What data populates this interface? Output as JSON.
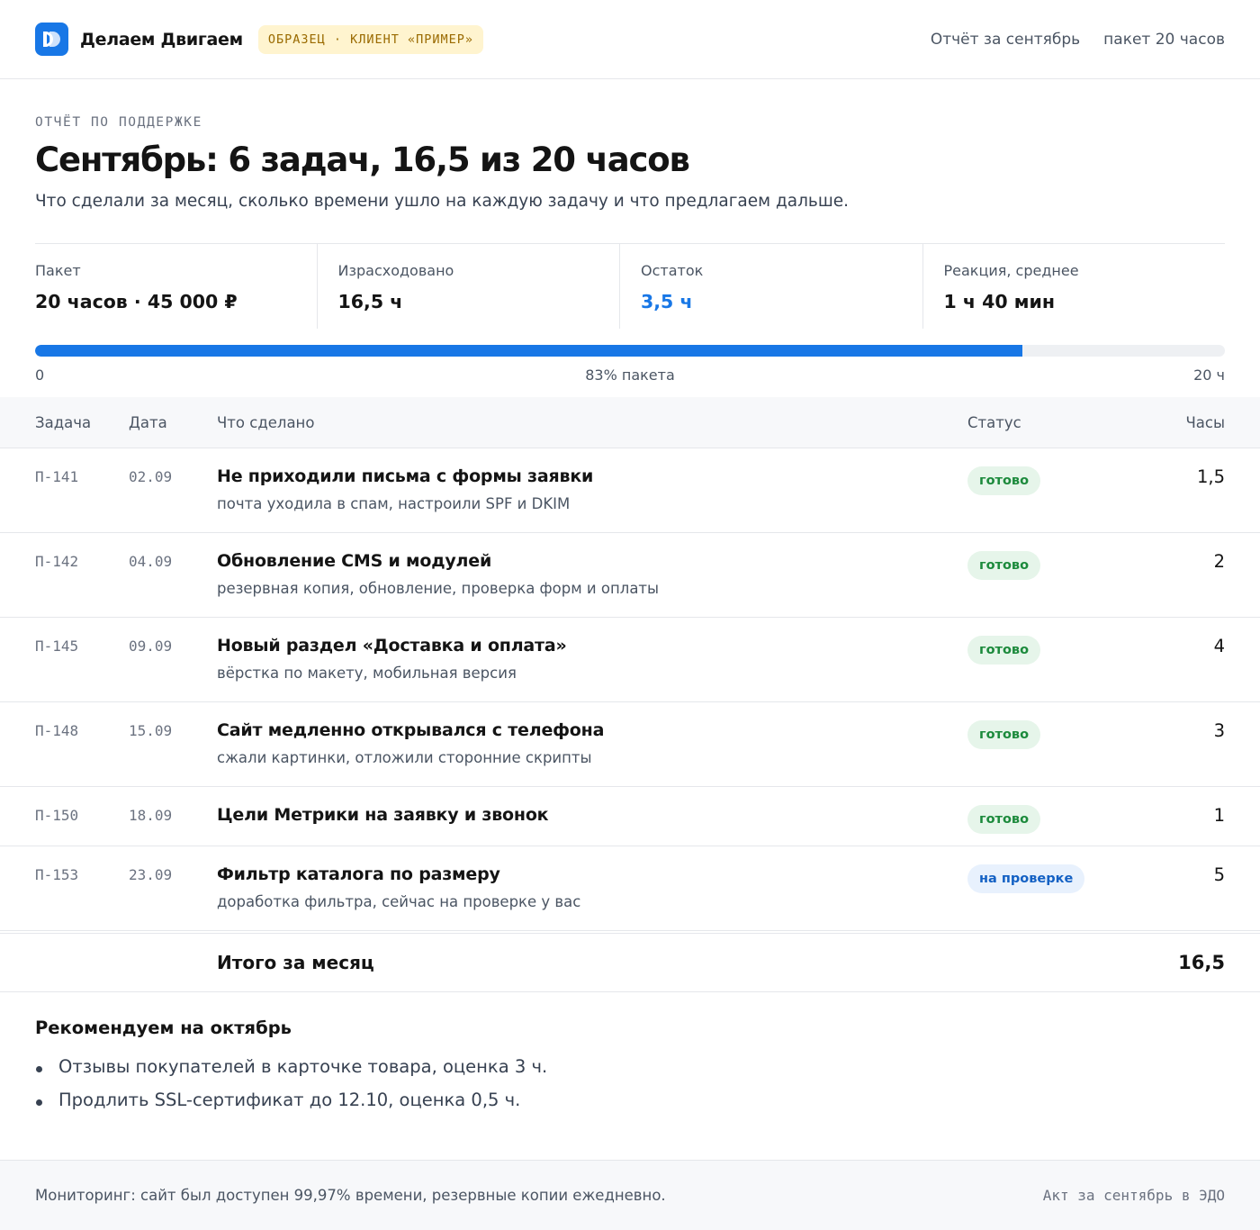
{
  "header": {
    "brand": "Делаем Двигаем",
    "sample_badge": "ОБРАЗЕЦ · КЛИЕНТ «ПРИМЕР»",
    "report_link": "Отчёт за сентябрь",
    "package_link": "пакет 20 часов"
  },
  "hero": {
    "eyebrow": "ОТЧЁТ ПО ПОДДЕРЖКЕ",
    "title": "Сентябрь: 6 задач, 16,5 из 20 часов",
    "lead": "Что сделали за месяц, сколько времени ушло на каждую задачу и что предлагаем дальше."
  },
  "stats": [
    {
      "label": "Пакет",
      "value": "20 часов · 45 000 ₽"
    },
    {
      "label": "Израсходовано",
      "value": "16,5 ч"
    },
    {
      "label": "Остаток",
      "value": "3,5 ч"
    },
    {
      "label": "Реакция, среднее",
      "value": "1 ч 40 мин"
    }
  ],
  "progress": {
    "used_fraction": 0.83,
    "min_label": "0",
    "mid_label": "83% пакета",
    "max_label": "20 ч"
  },
  "table": {
    "headers": {
      "id": "Задача",
      "date": "Дата",
      "what": "Что сделано",
      "status": "Статус",
      "hours": "Часы"
    },
    "rows": [
      {
        "id": "П-141",
        "date": "02.09",
        "title": "Не приходили письма с формы заявки",
        "sub": "почта уходила в спам, настроили SPF и DKIM",
        "status": "готово",
        "status_kind": "done",
        "hours": "1,5"
      },
      {
        "id": "П-142",
        "date": "04.09",
        "title": "Обновление CMS и модулей",
        "sub": "резервная копия, обновление, проверка форм и оплаты",
        "status": "готово",
        "status_kind": "done",
        "hours": "2"
      },
      {
        "id": "П-145",
        "date": "09.09",
        "title": "Новый раздел «Доставка и оплата»",
        "sub": "вёрстка по макету, мобильная версия",
        "status": "готово",
        "status_kind": "done",
        "hours": "4"
      },
      {
        "id": "П-148",
        "date": "15.09",
        "title": "Сайт медленно открывался с телефона",
        "sub": "сжали картинки, отложили сторонние скрипты",
        "status": "готово",
        "status_kind": "done",
        "hours": "3"
      },
      {
        "id": "П-150",
        "date": "18.09",
        "title": "Цели Метрики на заявку и звонок",
        "sub": "",
        "status": "готово",
        "status_kind": "done",
        "hours": "1"
      },
      {
        "id": "П-153",
        "date": "23.09",
        "title": "Фильтр каталога по размеру",
        "sub": "доработка фильтра, сейчас на проверке у вас",
        "status": "на проверке",
        "status_kind": "review",
        "hours": "5"
      }
    ],
    "total_label": "Итого за месяц",
    "total_value": "16,5"
  },
  "recommendations": {
    "title": "Рекомендуем на октябрь",
    "items": [
      "Отзывы покупателей в карточке товара, оценка 3 ч.",
      "Продлить SSL-сертификат до 12.10, оценка 0,5 ч."
    ]
  },
  "footer": {
    "monitoring": "Мониторинг: сайт был доступен 99,97% времени, резервные копии ежедневно.",
    "act": "Акт за сентябрь в ЭДО"
  },
  "colors": {
    "accent": "#1877e6",
    "done_bg": "#e6f5ea",
    "done_text": "#1c8a3c",
    "review_bg": "#e8f1fd",
    "review_text": "#1461c4",
    "sample_bg": "#fff4cf"
  }
}
